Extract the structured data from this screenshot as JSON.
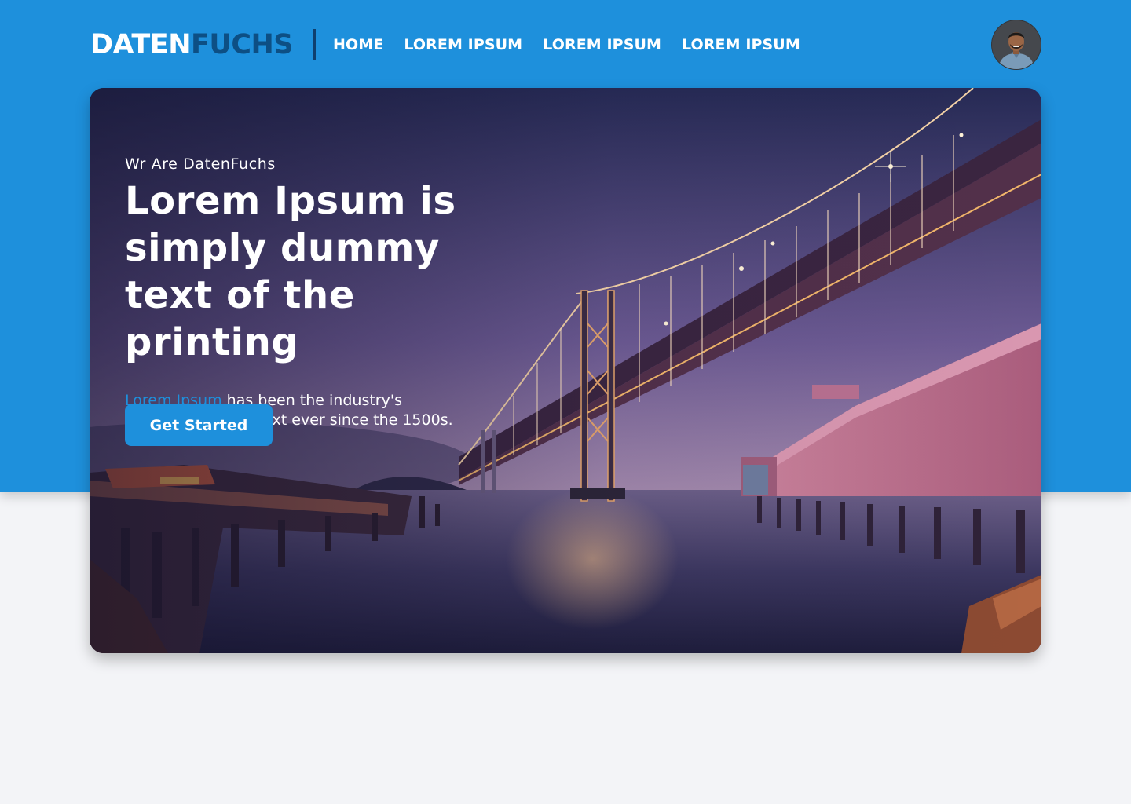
{
  "brand": {
    "part1": "DATEN",
    "part2": "FUCHS"
  },
  "nav": {
    "items": [
      {
        "label": "HOME"
      },
      {
        "label": "LOREM IPSUM"
      },
      {
        "label": "LOREM IPSUM"
      },
      {
        "label": "LOREM IPSUM"
      }
    ]
  },
  "hero": {
    "eyebrow": "Wr Are DatenFuchs",
    "headline": "Lorem Ipsum is simply dummy text of the printing",
    "description_accent": "Lorem Ipsum",
    "description_rest": " has been the industry's standard dummy text ever since the 1500s.",
    "cta_label": "Get Started"
  },
  "colors": {
    "primary": "#1e90dc",
    "brand_dark": "#0d4f84",
    "page_background": "#f3f4f7"
  }
}
